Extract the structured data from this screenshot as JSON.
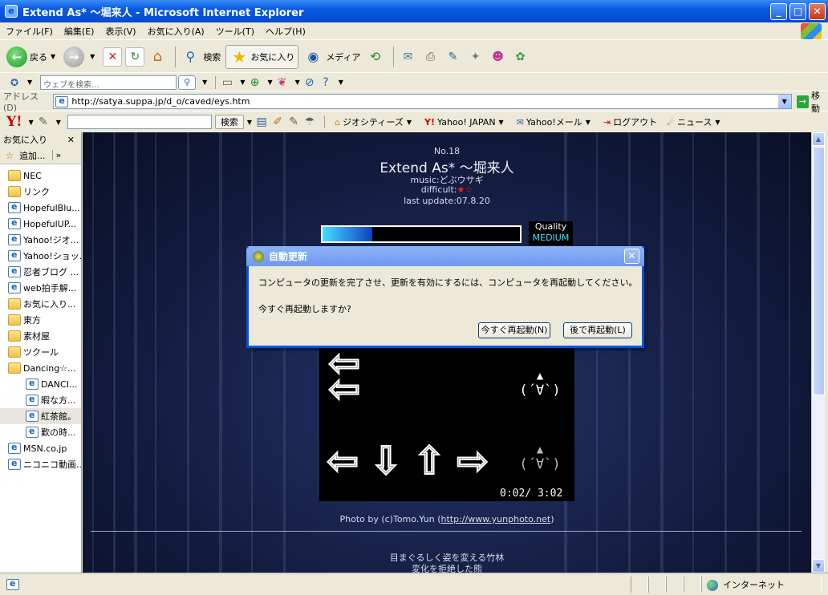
{
  "window": {
    "title": "Extend As* 〜堀来人 - Microsoft Internet Explorer",
    "min_glyph": "_",
    "max_glyph": "□",
    "close_glyph": "✕"
  },
  "menu": [
    "ファイル(F)",
    "編集(E)",
    "表示(V)",
    "お気に入り(A)",
    "ツール(T)",
    "ヘルプ(H)"
  ],
  "toolbar": {
    "back_label": "戻る",
    "search_label": "検索",
    "favorites_label": "お気に入り",
    "media_label": "メディア"
  },
  "linkbar": {
    "search_placeholder": "ウェブを検索..."
  },
  "address": {
    "label": "アドレス(D)",
    "url": "http://satya.suppa.jp/d_o/caved/eys.htm",
    "go_label": "移動"
  },
  "yahoo_toolbar": {
    "logo": "Y!",
    "search_button": "検索",
    "geocities": "ジオシティーズ",
    "yahoo_japan": "Yahoo! JAPAN",
    "yahoo_mail": "Yahoo!メール",
    "logout": "ログアウト",
    "news": "ニュース"
  },
  "favorites": {
    "header": "お気に入り",
    "close": "✕",
    "add_label": "追加...",
    "items": [
      {
        "label": "NEC",
        "type": "folder",
        "sub": false
      },
      {
        "label": "リンク",
        "type": "folder",
        "sub": false
      },
      {
        "label": "HopefulBlu...",
        "type": "page",
        "sub": false
      },
      {
        "label": "HopefulUP...",
        "type": "page",
        "sub": false
      },
      {
        "label": "Yahoo!ジオ...",
        "type": "page",
        "sub": false
      },
      {
        "label": "Yahoo!ショッ...",
        "type": "page",
        "sub": false
      },
      {
        "label": "忍者ブログ ...",
        "type": "page",
        "sub": false
      },
      {
        "label": "web拍手解...",
        "type": "page",
        "sub": false
      },
      {
        "label": "お気に入り...",
        "type": "folder",
        "sub": false
      },
      {
        "label": "東方",
        "type": "folder",
        "sub": false
      },
      {
        "label": "素材屋",
        "type": "folder",
        "sub": false
      },
      {
        "label": "ツクール",
        "type": "folder",
        "sub": false
      },
      {
        "label": "Dancing☆...",
        "type": "folder",
        "sub": false
      },
      {
        "label": "DANCI...",
        "type": "page",
        "sub": true
      },
      {
        "label": "暇な方...",
        "type": "page",
        "sub": true
      },
      {
        "label": "紅茶館。",
        "type": "page",
        "sub": true
      },
      {
        "label": "歎の時...",
        "type": "page",
        "sub": true
      },
      {
        "label": "MSN.co.jp",
        "type": "page",
        "sub": false
      },
      {
        "label": "ニコニコ動画...",
        "type": "page",
        "sub": false
      }
    ]
  },
  "song": {
    "number": "No.18",
    "title": "Extend As* 〜堀来人",
    "music": "music:どぶウサギ",
    "difficult_label": "difficult:",
    "difficult_stars": "★☆",
    "last_update": "last update:07.8.20"
  },
  "game": {
    "quality_label": "Quality",
    "quality_value": "MEDIUM",
    "quality_level": 0.25,
    "face": "(´∀`)",
    "timer": "0:02/ 3:02"
  },
  "photo_credit": {
    "prefix": "Photo by (c)Tomo.Yun (",
    "link": "http://www.yunphoto.net",
    "suffix": ")"
  },
  "footer_text": {
    "line1": "目まぐるしく姿を変える竹林",
    "line2": "変化を拒絶した熊"
  },
  "dialog": {
    "title": "自動更新",
    "close": "✕",
    "message": "コンピュータの更新を完了させ、更新を有効にするには、コンピュータを再起動してください。",
    "question": "今すぐ再起動しますか?",
    "restart_now": "今すぐ再起動(N)",
    "restart_later": "後で再起動(L)"
  },
  "status": {
    "zone": "インターネット"
  },
  "colors": {
    "titlebar": "#0549D0",
    "dialog_border": "#0054E3",
    "quality_text": "#40E0FF",
    "star_red": "#FF2020"
  }
}
